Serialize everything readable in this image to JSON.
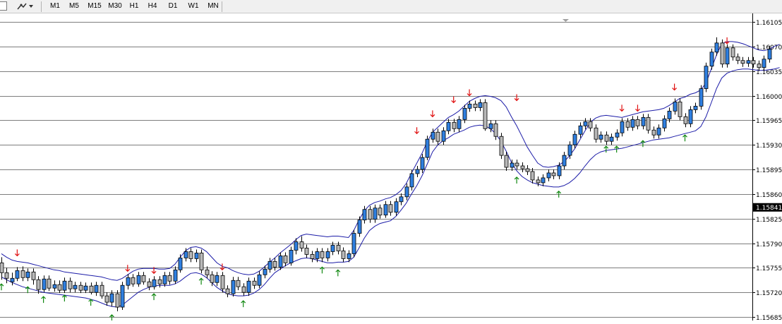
{
  "toolbar": {
    "timeframes": [
      "M1",
      "M5",
      "M15",
      "M30",
      "H1",
      "H4",
      "D1",
      "W1",
      "MN"
    ]
  },
  "colors": {
    "bull_body": "#2f7fe0",
    "bear_body": "#b8b8b8",
    "channel": "#1c1ca8",
    "arrow_down": "#e01010",
    "arrow_up": "#118811",
    "price_label_bg": "#000000",
    "price_label_fg": "#ffffff"
  },
  "chart_data": {
    "type": "candlestick",
    "title": "",
    "xlabel": "",
    "ylabel": "",
    "ylim": [
      1.15685,
      1.16105
    ],
    "y_ticks": [
      "1.16105",
      "1.16070",
      "1.16035",
      "1.16000",
      "1.15965",
      "1.15930",
      "1.15895",
      "1.15860",
      "1.15825",
      "1.15790",
      "1.15755",
      "1.15720",
      "1.15685"
    ],
    "current_price": "1.15841",
    "grid": "horizontal",
    "candles": [
      [
        1.15762,
        1.15748,
        1.1577,
        1.15738
      ],
      [
        1.15748,
        1.1574,
        1.15755,
        1.15733
      ],
      [
        1.15735,
        1.1574,
        1.15748,
        1.1573
      ],
      [
        1.1574,
        1.15751,
        1.15756,
        1.15736
      ],
      [
        1.15751,
        1.15741,
        1.15757,
        1.15736
      ],
      [
        1.15741,
        1.15749,
        1.15754,
        1.15736
      ],
      [
        1.15749,
        1.15738,
        1.15754,
        1.15731
      ],
      [
        1.15738,
        1.15724,
        1.15743,
        1.15718
      ],
      [
        1.15724,
        1.15739,
        1.15744,
        1.1572
      ],
      [
        1.15739,
        1.15726,
        1.15744,
        1.15722
      ],
      [
        1.15726,
        1.15731,
        1.15737,
        1.15721
      ],
      [
        1.15731,
        1.15723,
        1.15737,
        1.15719
      ],
      [
        1.15723,
        1.15736,
        1.15741,
        1.15719
      ],
      [
        1.15736,
        1.15725,
        1.15741,
        1.1572
      ],
      [
        1.15725,
        1.1573,
        1.15735,
        1.1572
      ],
      [
        1.1573,
        1.15723,
        1.15735,
        1.15719
      ],
      [
        1.15723,
        1.15729,
        1.15734,
        1.15719
      ],
      [
        1.15729,
        1.1572,
        1.15734,
        1.15717
      ],
      [
        1.1572,
        1.1573,
        1.15735,
        1.15715
      ],
      [
        1.1573,
        1.15715,
        1.15735,
        1.15711
      ],
      [
        1.15715,
        1.15706,
        1.1572,
        1.15701
      ],
      [
        1.15706,
        1.15718,
        1.15723,
        1.157
      ],
      [
        1.15718,
        1.15699,
        1.15723,
        1.15693
      ],
      [
        1.15699,
        1.1573,
        1.15735,
        1.15695
      ],
      [
        1.1573,
        1.15741,
        1.15746,
        1.15724
      ],
      [
        1.15741,
        1.15732,
        1.15746,
        1.15728
      ],
      [
        1.15732,
        1.15744,
        1.15749,
        1.15728
      ],
      [
        1.15744,
        1.15735,
        1.15749,
        1.15731
      ],
      [
        1.15735,
        1.15728,
        1.1574,
        1.15723
      ],
      [
        1.15728,
        1.15738,
        1.15743,
        1.15724
      ],
      [
        1.15738,
        1.15732,
        1.15743,
        1.15727
      ],
      [
        1.15732,
        1.15744,
        1.15749,
        1.15728
      ],
      [
        1.15744,
        1.15736,
        1.15749,
        1.15731
      ],
      [
        1.15736,
        1.15752,
        1.15757,
        1.15732
      ],
      [
        1.15752,
        1.15769,
        1.15774,
        1.15748
      ],
      [
        1.15769,
        1.15778,
        1.15783,
        1.15764
      ],
      [
        1.15778,
        1.15768,
        1.15783,
        1.15763
      ],
      [
        1.15768,
        1.15776,
        1.15781,
        1.15763
      ],
      [
        1.15776,
        1.15752,
        1.15781,
        1.15747
      ],
      [
        1.15752,
        1.15745,
        1.15757,
        1.1574
      ],
      [
        1.15745,
        1.15734,
        1.1575,
        1.15729
      ],
      [
        1.15734,
        1.15744,
        1.15749,
        1.15729
      ],
      [
        1.15744,
        1.15725,
        1.15749,
        1.1572
      ],
      [
        1.15725,
        1.15718,
        1.1573,
        1.15713
      ],
      [
        1.15718,
        1.15737,
        1.15742,
        1.15714
      ],
      [
        1.15737,
        1.15728,
        1.15742,
        1.15723
      ],
      [
        1.15728,
        1.1572,
        1.15733,
        1.15715
      ],
      [
        1.1572,
        1.15736,
        1.15741,
        1.15715
      ],
      [
        1.15736,
        1.1573,
        1.15741,
        1.15725
      ],
      [
        1.1573,
        1.15745,
        1.1575,
        1.15726
      ],
      [
        1.15745,
        1.15753,
        1.15758,
        1.1574
      ],
      [
        1.15753,
        1.15764,
        1.15769,
        1.15748
      ],
      [
        1.15764,
        1.15756,
        1.15769,
        1.15751
      ],
      [
        1.15756,
        1.15772,
        1.15777,
        1.15752
      ],
      [
        1.15772,
        1.15762,
        1.15777,
        1.15757
      ],
      [
        1.15762,
        1.1578,
        1.15785,
        1.15758
      ],
      [
        1.1578,
        1.15792,
        1.15797,
        1.15774
      ],
      [
        1.15792,
        1.15783,
        1.158,
        1.15778
      ],
      [
        1.15783,
        1.15774,
        1.15788,
        1.15769
      ],
      [
        1.15774,
        1.15768,
        1.15779,
        1.15763
      ],
      [
        1.15768,
        1.15778,
        1.15783,
        1.15763
      ],
      [
        1.15778,
        1.15769,
        1.15783,
        1.15763
      ],
      [
        1.15769,
        1.15778,
        1.15783,
        1.15764
      ],
      [
        1.15778,
        1.15787,
        1.15792,
        1.15773
      ],
      [
        1.15787,
        1.15779,
        1.15792,
        1.15774
      ],
      [
        1.15779,
        1.15768,
        1.15784,
        1.15763
      ],
      [
        1.15768,
        1.15775,
        1.1578,
        1.15763
      ],
      [
        1.15775,
        1.15804,
        1.15809,
        1.1577
      ],
      [
        1.15804,
        1.15823,
        1.15828,
        1.15799
      ],
      [
        1.15823,
        1.15838,
        1.15843,
        1.15818
      ],
      [
        1.15838,
        1.15824,
        1.15843,
        1.15819
      ],
      [
        1.15824,
        1.1584,
        1.15845,
        1.15819
      ],
      [
        1.1584,
        1.1583,
        1.15845,
        1.15825
      ],
      [
        1.1583,
        1.15845,
        1.1585,
        1.15826
      ],
      [
        1.15845,
        1.15834,
        1.1585,
        1.15829
      ],
      [
        1.15834,
        1.15849,
        1.15854,
        1.15829
      ],
      [
        1.15849,
        1.15856,
        1.15861,
        1.15844
      ],
      [
        1.15856,
        1.1587,
        1.15875,
        1.15851
      ],
      [
        1.1587,
        1.15889,
        1.15894,
        1.15865
      ],
      [
        1.15889,
        1.15895,
        1.159,
        1.15884
      ],
      [
        1.15895,
        1.15912,
        1.15917,
        1.1589
      ],
      [
        1.15912,
        1.15938,
        1.15943,
        1.15908
      ],
      [
        1.15938,
        1.15948,
        1.15953,
        1.15933
      ],
      [
        1.15948,
        1.15935,
        1.15953,
        1.1593
      ],
      [
        1.15935,
        1.1595,
        1.15955,
        1.1593
      ],
      [
        1.1595,
        1.15962,
        1.15967,
        1.15945
      ],
      [
        1.15962,
        1.15953,
        1.15967,
        1.15948
      ],
      [
        1.15953,
        1.15966,
        1.15971,
        1.15948
      ],
      [
        1.15966,
        1.15982,
        1.15987,
        1.15961
      ],
      [
        1.15982,
        1.15988,
        1.15993,
        1.15977
      ],
      [
        1.15988,
        1.15983,
        1.15993,
        1.15978
      ],
      [
        1.15983,
        1.1599,
        1.15995,
        1.15978
      ],
      [
        1.1599,
        1.15953,
        1.15995,
        1.1595
      ],
      [
        1.15953,
        1.1596,
        1.15965,
        1.15948
      ],
      [
        1.1596,
        1.15942,
        1.15965,
        1.15937
      ],
      [
        1.15942,
        1.15915,
        1.15947,
        1.1591
      ],
      [
        1.15915,
        1.15898,
        1.1592,
        1.15893
      ],
      [
        1.15898,
        1.15904,
        1.15909,
        1.15893
      ],
      [
        1.15904,
        1.159,
        1.15909,
        1.15895
      ],
      [
        1.159,
        1.15896,
        1.15905,
        1.15891
      ],
      [
        1.15896,
        1.15892,
        1.15901,
        1.15887
      ],
      [
        1.15892,
        1.1588,
        1.15897,
        1.15875
      ],
      [
        1.1588,
        1.15876,
        1.15885,
        1.15871
      ],
      [
        1.15876,
        1.15883,
        1.15888,
        1.15871
      ],
      [
        1.15883,
        1.1589,
        1.15895,
        1.15878
      ],
      [
        1.1589,
        1.15886,
        1.15895,
        1.15881
      ],
      [
        1.15886,
        1.159,
        1.15905,
        1.15881
      ],
      [
        1.159,
        1.15915,
        1.1592,
        1.15895
      ],
      [
        1.15915,
        1.1593,
        1.15935,
        1.1591
      ],
      [
        1.1593,
        1.15945,
        1.1595,
        1.15925
      ],
      [
        1.15945,
        1.15957,
        1.15962,
        1.1594
      ],
      [
        1.15957,
        1.15963,
        1.15968,
        1.15952
      ],
      [
        1.15963,
        1.15954,
        1.15968,
        1.15949
      ],
      [
        1.15954,
        1.15938,
        1.15959,
        1.15933
      ],
      [
        1.15938,
        1.15944,
        1.15949,
        1.15933
      ],
      [
        1.15944,
        1.15935,
        1.15949,
        1.1593
      ],
      [
        1.15935,
        1.15941,
        1.15946,
        1.1593
      ],
      [
        1.15941,
        1.15947,
        1.15952,
        1.15936
      ],
      [
        1.15947,
        1.15963,
        1.15968,
        1.15942
      ],
      [
        1.15963,
        1.15955,
        1.15968,
        1.1595
      ],
      [
        1.15955,
        1.15966,
        1.15971,
        1.1595
      ],
      [
        1.15966,
        1.15957,
        1.15971,
        1.15952
      ],
      [
        1.15957,
        1.15969,
        1.15974,
        1.15952
      ],
      [
        1.15969,
        1.15951,
        1.15974,
        1.15946
      ],
      [
        1.15951,
        1.15944,
        1.15956,
        1.15939
      ],
      [
        1.15944,
        1.15954,
        1.15959,
        1.15939
      ],
      [
        1.15954,
        1.15967,
        1.15972,
        1.15949
      ],
      [
        1.15967,
        1.15978,
        1.15983,
        1.15962
      ],
      [
        1.15978,
        1.15991,
        1.15996,
        1.15973
      ],
      [
        1.15991,
        1.1597,
        1.15996,
        1.15965
      ],
      [
        1.1597,
        1.1596,
        1.15975,
        1.15955
      ],
      [
        1.1596,
        1.1598,
        1.15985,
        1.15955
      ],
      [
        1.1598,
        1.15985,
        1.1599,
        1.15975
      ],
      [
        1.15985,
        1.1601,
        1.16015,
        1.1598
      ],
      [
        1.1601,
        1.16042,
        1.16047,
        1.16005
      ],
      [
        1.16042,
        1.16062,
        1.16067,
        1.16037
      ],
      [
        1.16062,
        1.16075,
        1.16083,
        1.16057
      ],
      [
        1.16075,
        1.16045,
        1.1608,
        1.1604
      ],
      [
        1.16045,
        1.16068,
        1.16073,
        1.1604
      ],
      [
        1.16068,
        1.16055,
        1.16073,
        1.1605
      ],
      [
        1.16055,
        1.1605,
        1.1606,
        1.16045
      ],
      [
        1.1605,
        1.16046,
        1.16055,
        1.16041
      ],
      [
        1.16046,
        1.1605,
        1.16055,
        1.16041
      ],
      [
        1.1605,
        1.16045,
        1.16055,
        1.1604
      ],
      [
        1.16045,
        1.1604,
        1.1605,
        1.16035
      ],
      [
        1.1604,
        1.16052,
        1.16057,
        1.16035
      ],
      [
        1.16052,
        1.16066,
        1.16071,
        1.16047
      ]
    ],
    "channel_upper": [
      1.15775,
      1.1577,
      1.15766,
      1.15764,
      1.15763,
      1.15762,
      1.1576,
      1.15758,
      1.15756,
      1.15754,
      1.15752,
      1.15751,
      1.15749,
      1.15748,
      1.15747,
      1.15746,
      1.15745,
      1.15744,
      1.15743,
      1.15742,
      1.1574,
      1.15738,
      1.15737,
      1.1574,
      1.15745,
      1.1575,
      1.15753,
      1.15754,
      1.15754,
      1.15754,
      1.15753,
      1.15753,
      1.15754,
      1.1576,
      1.1577,
      1.15779,
      1.15784,
      1.15785,
      1.15783,
      1.15778,
      1.1577,
      1.15762,
      1.15757,
      1.15755,
      1.15751,
      1.15748,
      1.15746,
      1.15745,
      1.15746,
      1.1575,
      1.15756,
      1.15763,
      1.15769,
      1.15776,
      1.15782,
      1.15788,
      1.15795,
      1.15801,
      1.15803,
      1.15802,
      1.15801,
      1.158,
      1.15799,
      1.158,
      1.158,
      1.15799,
      1.15798,
      1.15808,
      1.15823,
      1.15836,
      1.15844,
      1.15848,
      1.1585,
      1.15853,
      1.15855,
      1.15859,
      1.15865,
      1.15875,
      1.1589,
      1.15904,
      1.15918,
      1.15935,
      1.15948,
      1.15955,
      1.15962,
      1.15969,
      1.15973,
      1.15978,
      1.15985,
      1.15992,
      1.15996,
      1.15999,
      1.16,
      1.15999,
      1.15997,
      1.15993,
      1.15984,
      1.1597,
      1.15957,
      1.15942,
      1.15927,
      1.15915,
      1.15904,
      1.15899,
      1.15898,
      1.15899,
      1.15901,
      1.15906,
      1.15914,
      1.15924,
      1.15937,
      1.1595,
      1.15962,
      1.15968,
      1.15971,
      1.15972,
      1.15971,
      1.1597,
      1.15969,
      1.15971,
      1.15973,
      1.15975,
      1.15977,
      1.15978,
      1.15979,
      1.1598,
      1.15982,
      1.15986,
      1.15991,
      1.15996,
      1.15998,
      1.16002,
      1.16004,
      1.16008,
      1.16018,
      1.16038,
      1.16058,
      1.16074,
      1.16077,
      1.16077,
      1.16076,
      1.16074,
      1.16071,
      1.16068,
      1.16065,
      1.16064,
      1.16066,
      1.1607,
      1.16073
    ],
    "channel_lower": [
      1.15742,
      1.15738,
      1.15734,
      1.15731,
      1.15728,
      1.15726,
      1.15724,
      1.15722,
      1.1572,
      1.15719,
      1.15718,
      1.15717,
      1.15716,
      1.15715,
      1.15714,
      1.15713,
      1.15712,
      1.1571,
      1.15708,
      1.15705,
      1.15702,
      1.157,
      1.15699,
      1.15702,
      1.15708,
      1.15714,
      1.1572,
      1.15724,
      1.15727,
      1.15729,
      1.1573,
      1.1573,
      1.1573,
      1.15732,
      1.15736,
      1.15742,
      1.15747,
      1.15748,
      1.15746,
      1.15741,
      1.15734,
      1.15727,
      1.15722,
      1.15718,
      1.15716,
      1.15715,
      1.15715,
      1.15716,
      1.15719,
      1.15724,
      1.15731,
      1.1574,
      1.15748,
      1.15753,
      1.15758,
      1.15762,
      1.15765,
      1.15768,
      1.15769,
      1.15768,
      1.15766,
      1.15764,
      1.15762,
      1.15762,
      1.15763,
      1.15763,
      1.15764,
      1.1577,
      1.15783,
      1.15797,
      1.15808,
      1.15814,
      1.15818,
      1.1582,
      1.15822,
      1.15828,
      1.15837,
      1.15847,
      1.1586,
      1.15872,
      1.15886,
      1.15903,
      1.1592,
      1.1593,
      1.15936,
      1.1594,
      1.15945,
      1.15948,
      1.15951,
      1.15955,
      1.15957,
      1.15958,
      1.15957,
      1.15953,
      1.15946,
      1.15935,
      1.15921,
      1.15905,
      1.15893,
      1.15885,
      1.1588,
      1.15876,
      1.15874,
      1.15872,
      1.15871,
      1.1587,
      1.1587,
      1.15872,
      1.15876,
      1.15882,
      1.1589,
      1.159,
      1.15909,
      1.15916,
      1.1592,
      1.15922,
      1.15923,
      1.15924,
      1.15925,
      1.15927,
      1.15929,
      1.15931,
      1.15933,
      1.15935,
      1.15937,
      1.15938,
      1.15939,
      1.1594,
      1.15942,
      1.15944,
      1.15946,
      1.15948,
      1.1595,
      1.15956,
      1.1597,
      1.1599,
      1.1601,
      1.16025,
      1.16032,
      1.16035,
      1.16037,
      1.16038,
      1.16038,
      1.16037,
      1.16036,
      1.16036,
      1.16037,
      1.16038,
      1.1604
    ],
    "down_arrows": [
      [
        3,
        1.15772
      ],
      [
        24,
        1.1575
      ],
      [
        29,
        1.15747
      ],
      [
        42,
        1.15752
      ],
      [
        79,
        1.15946
      ],
      [
        82,
        1.1597
      ],
      [
        86,
        1.1599
      ],
      [
        89,
        1.16
      ],
      [
        98,
        1.15993
      ],
      [
        118,
        1.15978
      ],
      [
        121,
        1.15978
      ],
      [
        128,
        1.16008
      ],
      [
        138,
        1.16074
      ]
    ],
    "up_arrows": [
      [
        0,
        1.15732
      ],
      [
        5,
        1.15728
      ],
      [
        8,
        1.15714
      ],
      [
        12,
        1.15716
      ],
      [
        17,
        1.1571
      ],
      [
        21,
        1.15688
      ],
      [
        29,
        1.15718
      ],
      [
        38,
        1.1574
      ],
      [
        46,
        1.15708
      ],
      [
        61,
        1.15756
      ],
      [
        64,
        1.15752
      ],
      [
        98,
        1.15884
      ],
      [
        106,
        1.15864
      ],
      [
        115,
        1.15928
      ],
      [
        117,
        1.15928
      ],
      [
        122,
        1.15936
      ],
      [
        130,
        1.15944
      ]
    ]
  }
}
